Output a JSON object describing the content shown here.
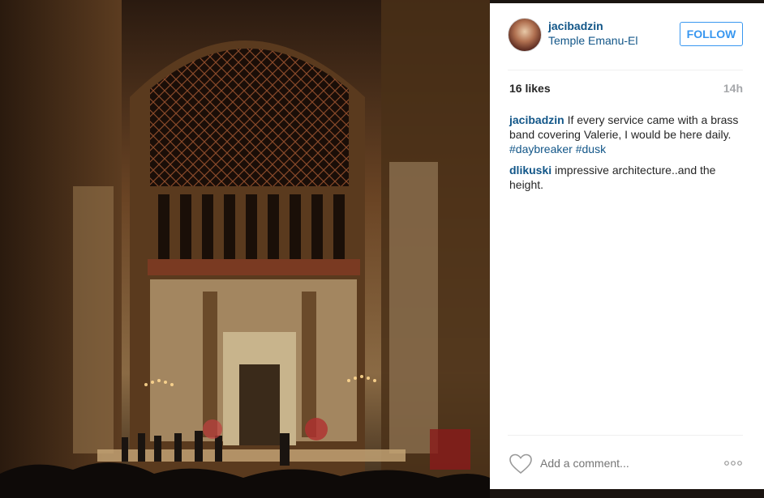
{
  "post": {
    "username": "jacibadzin",
    "location": "Temple Emanu-El",
    "follow_label": "FOLLOW",
    "likes": "16 likes",
    "time": "14h",
    "comments": [
      {
        "user": "jacibadzin",
        "text": " If every service came with a brass band covering Valerie, I would be here daily. ",
        "tags": [
          "#daybreaker",
          "#dusk"
        ]
      },
      {
        "user": "dlikuski",
        "text": " impressive architecture..and the height."
      }
    ],
    "comment_placeholder": "Add a comment..."
  },
  "icons": {
    "like": "heart-icon",
    "options": "more-options-icon"
  },
  "colors": {
    "link": "#125688",
    "follow": "#3897f0",
    "muted": "#a5a7aa"
  }
}
